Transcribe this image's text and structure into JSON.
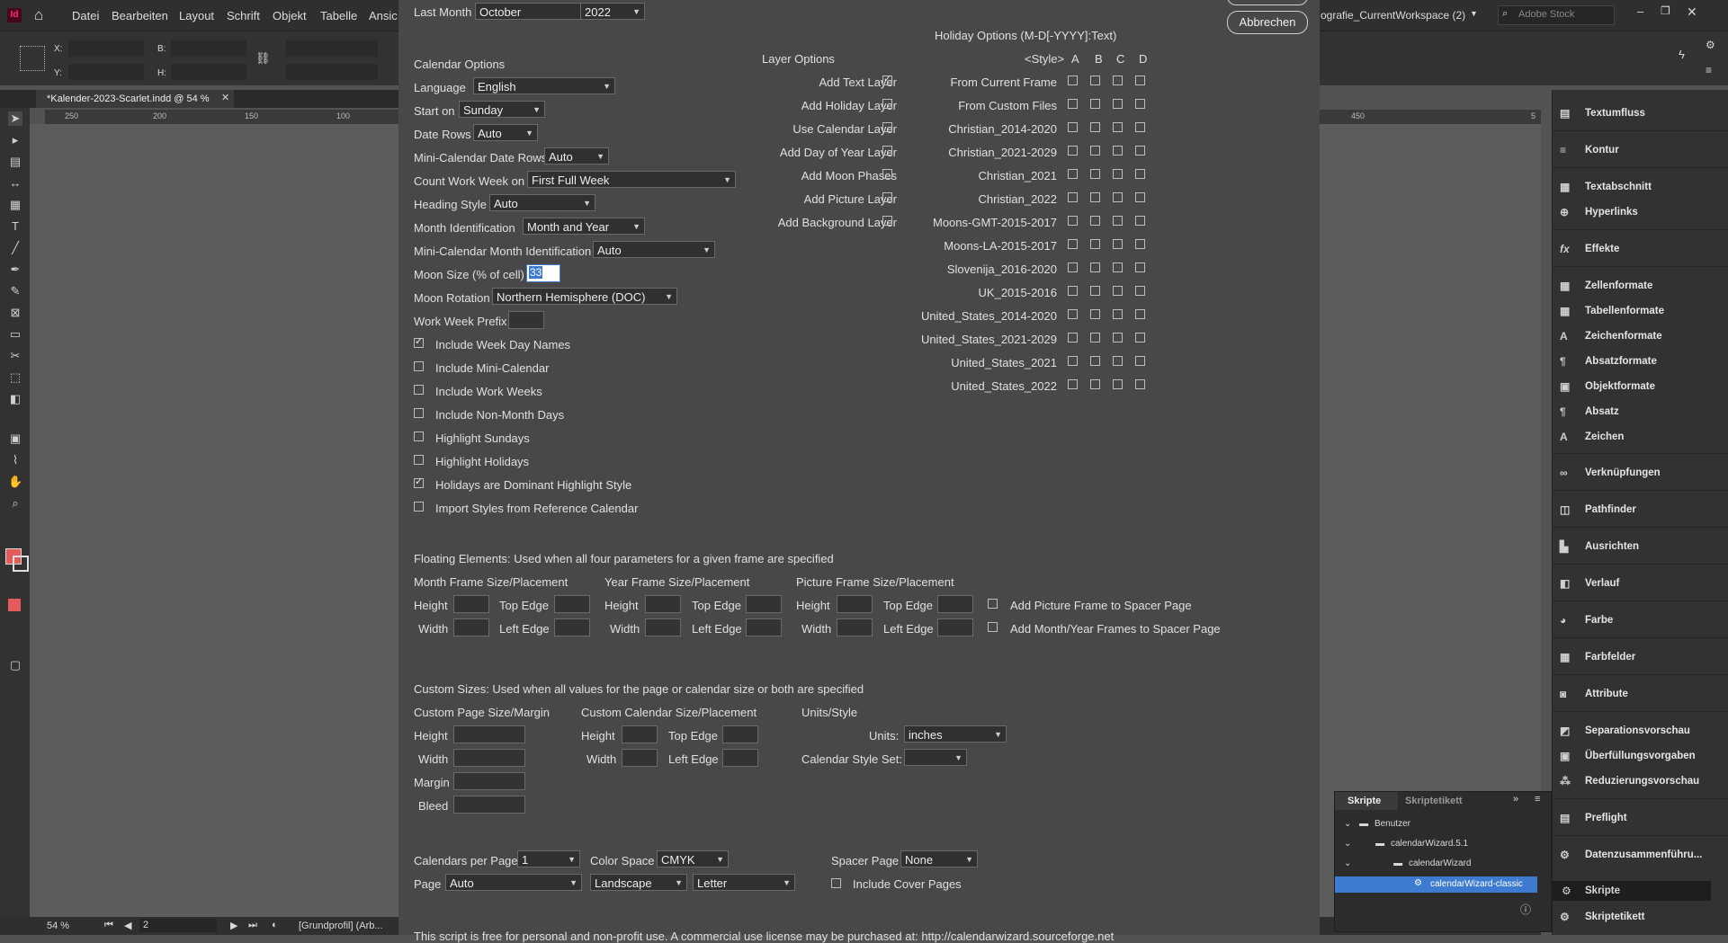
{
  "app": {
    "logo": "Id",
    "menus": [
      "Datei",
      "Bearbeiten",
      "Layout",
      "Schrift",
      "Objekt",
      "Tabelle",
      "Ansicht"
    ],
    "workspace": "ografie_CurrentWorkspace (2)",
    "search_placeholder": "Adobe Stock",
    "doc_tab": "*Kalender-2023-Scarlet.indd @ 54 %",
    "ruler_ticks": [
      "250",
      "200",
      "150",
      "100",
      "450",
      "5"
    ],
    "zoom": "54 %",
    "page_number": "2",
    "profile": "[Grundprofil] (Arb..."
  },
  "dialog": {
    "last_month_label": "Last Month",
    "last_month_value": "October",
    "last_year_value": "2022",
    "cancel_button": "Abbrechen",
    "calendar_options_title": "Calendar Options",
    "calendar_options": [
      {
        "label": "Language",
        "value": "English"
      },
      {
        "label": "Start on",
        "value": "Sunday"
      },
      {
        "label": "Date Rows",
        "value": "Auto"
      },
      {
        "label": "Mini-Calendar Date Rows",
        "value": "Auto"
      },
      {
        "label": "Count Work Week on",
        "value": "First Full Week"
      },
      {
        "label": "Heading Style",
        "value": "Auto"
      },
      {
        "label": "Month Identification",
        "value": "Month and Year"
      },
      {
        "label": "Mini-Calendar Month Identification",
        "value": "Auto"
      }
    ],
    "moon_size_label": "Moon Size (% of cell)",
    "moon_size_value": "33",
    "moon_rotation_label": "Moon Rotation",
    "moon_rotation_value": "Northern Hemisphere (DOC)",
    "work_week_prefix_label": "Work Week Prefix",
    "checkboxes": [
      {
        "label": "Include Week Day Names",
        "checked": true
      },
      {
        "label": "Include Mini-Calendar",
        "checked": false
      },
      {
        "label": "Include Work Weeks",
        "checked": false
      },
      {
        "label": "Include Non-Month Days",
        "checked": false
      },
      {
        "label": "Highlight Sundays",
        "checked": false
      },
      {
        "label": "Highlight Holidays",
        "checked": false
      },
      {
        "label": "Holidays are Dominant Highlight Style",
        "checked": true
      },
      {
        "label": "Import Styles from Reference Calendar",
        "checked": false
      }
    ],
    "layer_options_title": "Layer Options",
    "layers": [
      {
        "label": "Add Text Layer",
        "checked": true
      },
      {
        "label": "Add Holiday Layer",
        "checked": false
      },
      {
        "label": "Use Calendar Layer",
        "checked": false
      },
      {
        "label": "Add Day of Year Layer",
        "checked": false
      },
      {
        "label": "Add Moon Phases",
        "checked": false
      },
      {
        "label": "Add Picture Layer",
        "checked": false
      },
      {
        "label": "Add Background Layer",
        "checked": false
      }
    ],
    "holiday_title": "Holiday Options (M-D[-YYYY]:Text)",
    "holiday_style_header": "<Style>",
    "holiday_columns": [
      "A",
      "B",
      "C",
      "D"
    ],
    "holidays": [
      "From Current Frame",
      "From Custom Files",
      "Christian_2014-2020",
      "Christian_2021-2029",
      "Christian_2021",
      "Christian_2022",
      "Moons-GMT-2015-2017",
      "Moons-LA-2015-2017",
      "Slovenija_2016-2020",
      "UK_2015-2016",
      "United_States_2014-2020",
      "United_States_2021-2029",
      "United_States_2021",
      "United_States_2022"
    ],
    "floating_title": "Floating Elements: Used when all four parameters for a given frame are specified",
    "floating_groups": [
      {
        "title": "Month Frame Size/Placement"
      },
      {
        "title": "Year Frame Size/Placement"
      },
      {
        "title": "Picture Frame Size/Placement"
      }
    ],
    "lbl_height": "Height",
    "lbl_width": "Width",
    "lbl_top_edge": "Top Edge",
    "lbl_left_edge": "Left Edge",
    "add_picture_spacer": "Add Picture Frame to Spacer Page",
    "add_month_spacer": "Add Month/Year Frames to Spacer Page",
    "custom_title": "Custom Sizes: Used when all values for the page or calendar size or both are specified",
    "custom_page_title": "Custom Page Size/Margin",
    "custom_cal_title": "Custom Calendar Size/Placement",
    "units_title": "Units/Style",
    "lbl_margin": "Margin",
    "lbl_bleed": "Bleed",
    "units_label": "Units:",
    "units_value": "inches",
    "style_set_label": "Calendar Style Set:",
    "calendars_per_page_label": "Calendars per Page",
    "calendars_per_page_value": "1",
    "color_space_label": "Color Space",
    "color_space_value": "CMYK",
    "spacer_page_label": "Spacer Page",
    "spacer_page_value": "None",
    "page_label": "Page",
    "page_value": "Auto",
    "orientation_value": "Landscape",
    "paper_value": "Letter",
    "include_cover_label": "Include Cover Pages",
    "footer_text": "This script is free for personal and non-profit use.  A commercial use license may be purchased at: http://calendarwizard.sourceforge.net"
  },
  "panels": {
    "items": [
      "Textumfluss",
      "Kontur",
      "Textabschnitt",
      "Hyperlinks",
      "Effekte",
      "Zellenformate",
      "Tabellenformate",
      "Zeichenformate",
      "Absatzformate",
      "Objektformate",
      "Absatz",
      "Zeichen",
      "Verknüpfungen",
      "Pathfinder",
      "Ausrichten",
      "Verlauf",
      "Farbe",
      "Farbfelder",
      "Attribute",
      "Separationsvorschau",
      "Überfüllungsvorgaben",
      "Reduzierungsvorschau",
      "Preflight",
      "Datenzusammenführu...",
      "Skripte",
      "Skriptetikett"
    ]
  },
  "scripts_panel": {
    "tab_active": "Skripte",
    "tab_inactive": "Skriptetikett",
    "tree": [
      "Benutzer",
      "calendarWizard.5.1",
      "calendarWizard",
      "calendarWizard-classic"
    ]
  },
  "colors": {
    "dialog_bg": "#484848",
    "selection": "#3d7bd1",
    "fill_swatch": "#e35a5a"
  }
}
